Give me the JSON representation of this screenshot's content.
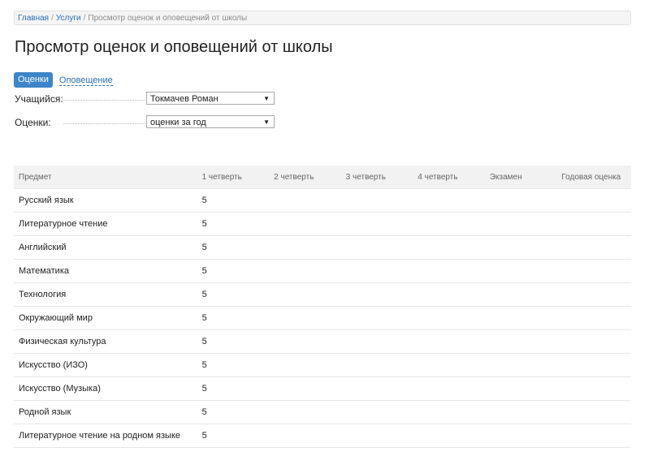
{
  "breadcrumb": {
    "home": "Главная",
    "services": "Услуги",
    "current": "Просмотр оценок и оповещений от школы"
  },
  "page_title": "Просмотр оценок и оповещений от школы",
  "tabs": {
    "grades": "Оценки",
    "notifications": "Оповещение"
  },
  "form": {
    "student_label": "Учащийся:",
    "student_value": "Токмачев Роман",
    "grades_label": "Оценки:",
    "grades_value": "оценки за год"
  },
  "table": {
    "headers": [
      "Предмет",
      "1 четверть",
      "2 четверть",
      "3 четверть",
      "4 четверть",
      "Экзамен",
      "Годовая оценка"
    ],
    "rows": [
      {
        "subject": "Русский язык",
        "q1": "5",
        "q2": "",
        "q3": "",
        "q4": "",
        "exam": "",
        "year": ""
      },
      {
        "subject": "Литературное чтение",
        "q1": "5",
        "q2": "",
        "q3": "",
        "q4": "",
        "exam": "",
        "year": ""
      },
      {
        "subject": "Английский",
        "q1": "5",
        "q2": "",
        "q3": "",
        "q4": "",
        "exam": "",
        "year": ""
      },
      {
        "subject": "Математика",
        "q1": "5",
        "q2": "",
        "q3": "",
        "q4": "",
        "exam": "",
        "year": ""
      },
      {
        "subject": "Технология",
        "q1": "5",
        "q2": "",
        "q3": "",
        "q4": "",
        "exam": "",
        "year": ""
      },
      {
        "subject": "Окружающий мир",
        "q1": "5",
        "q2": "",
        "q3": "",
        "q4": "",
        "exam": "",
        "year": ""
      },
      {
        "subject": "Физическая культура",
        "q1": "5",
        "q2": "",
        "q3": "",
        "q4": "",
        "exam": "",
        "year": ""
      },
      {
        "subject": "Искусство (ИЗО)",
        "q1": "5",
        "q2": "",
        "q3": "",
        "q4": "",
        "exam": "",
        "year": ""
      },
      {
        "subject": "Искусство (Музыка)",
        "q1": "5",
        "q2": "",
        "q3": "",
        "q4": "",
        "exam": "",
        "year": ""
      },
      {
        "subject": "Родной язык",
        "q1": "5",
        "q2": "",
        "q3": "",
        "q4": "",
        "exam": "",
        "year": ""
      },
      {
        "subject": "Литературное чтение на родном языке",
        "q1": "5",
        "q2": "",
        "q3": "",
        "q4": "",
        "exam": "",
        "year": ""
      }
    ]
  },
  "icons": {
    "dropdown": "chevron-down-icon"
  },
  "colors": {
    "accent": "#3d85c6",
    "link": "#2a6fb5",
    "header_bg": "#f2f2f2"
  }
}
